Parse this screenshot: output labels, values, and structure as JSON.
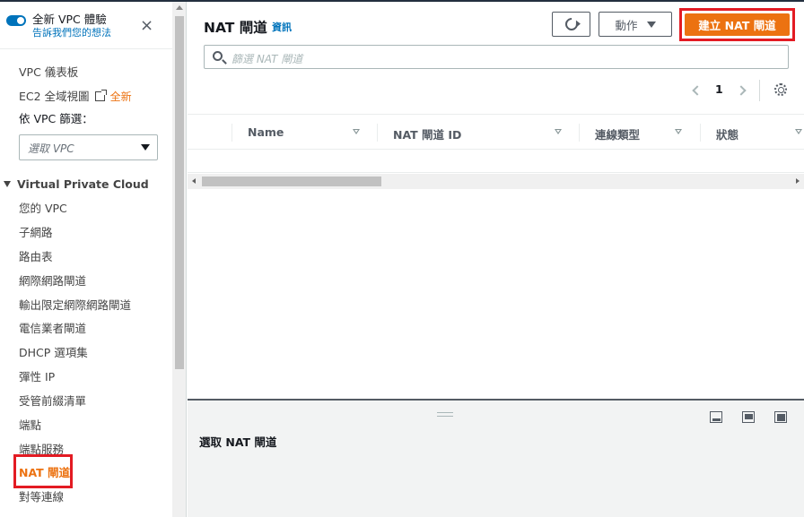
{
  "sidebar": {
    "toggle_title": "全新 VPC 體驗",
    "toggle_link": "告訴我們您的想法",
    "close_icon": "×",
    "items_top": [
      {
        "label": "VPC 儀表板"
      },
      {
        "label": "EC2 全域視圖",
        "badge": "全新"
      }
    ],
    "filter_label": "依 VPC 篩選：",
    "filter_placeholder": "選取 VPC",
    "section_title": "Virtual Private Cloud",
    "items": [
      {
        "label": "您的 VPC"
      },
      {
        "label": "子網路"
      },
      {
        "label": "路由表"
      },
      {
        "label": "網際網路閘道"
      },
      {
        "label": "輸出限定網際網路閘道"
      },
      {
        "label": "電信業者閘道"
      },
      {
        "label": "DHCP 選項集"
      },
      {
        "label": "彈性 IP"
      },
      {
        "label": "受管前綴清單"
      },
      {
        "label": "端點"
      },
      {
        "label": "端點服務"
      },
      {
        "label": "NAT 閘道"
      },
      {
        "label": "對等連線"
      }
    ]
  },
  "header": {
    "title": "NAT 閘道",
    "info": "資訊",
    "actions_label": "動作",
    "create_label": "建立 NAT 閘道"
  },
  "search": {
    "placeholder": "篩選 NAT 閘道"
  },
  "pager": {
    "page": "1"
  },
  "table": {
    "columns": [
      "Name",
      "NAT 閘道 ID",
      "連線類型",
      "狀態"
    ]
  },
  "detail": {
    "title": "選取 NAT 閘道"
  },
  "colors": {
    "accent": "#ec7211",
    "highlight": "#e31b23",
    "link": "#0073bb"
  },
  "icons": [
    "refresh-icon",
    "search-icon",
    "gear-icon",
    "close-icon",
    "external-link-icon",
    "chevron-left-icon",
    "chevron-right-icon"
  ]
}
